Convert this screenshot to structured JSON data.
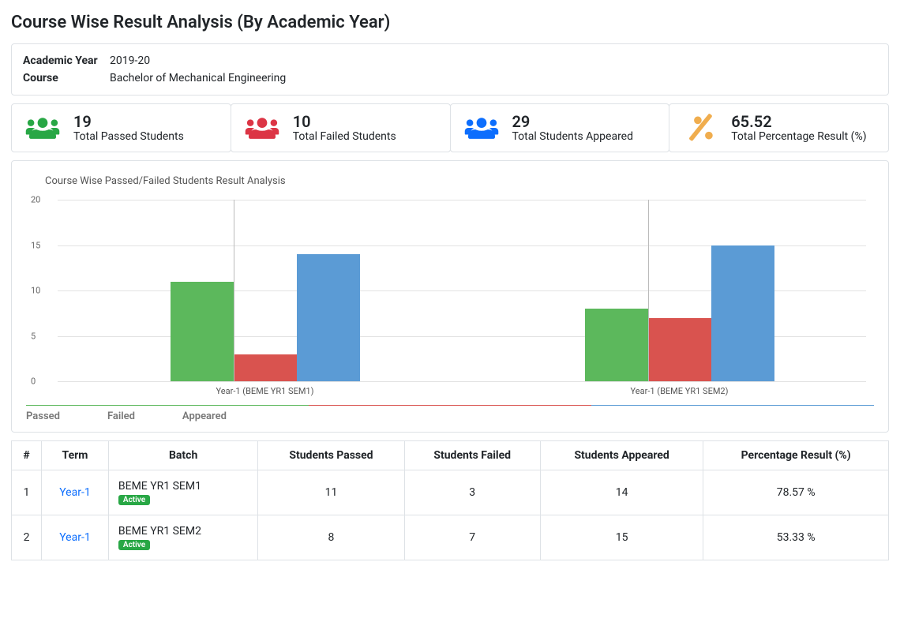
{
  "page_title": "Course Wise Result Analysis (By Academic Year)",
  "info": {
    "academic_year_label": "Academic Year",
    "academic_year_value": "2019-20",
    "course_label": "Course",
    "course_value": "Bachelor of Mechanical Engineering"
  },
  "stats": {
    "passed": {
      "value": "19",
      "label": "Total Passed Students"
    },
    "failed": {
      "value": "10",
      "label": "Total Failed Students"
    },
    "appeared": {
      "value": "29",
      "label": "Total Students Appeared"
    },
    "percentage": {
      "value": "65.52",
      "label": "Total Percentage Result (%)"
    }
  },
  "chart_title": "Course Wise Passed/Failed Students Result Analysis",
  "legend": {
    "passed": "Passed",
    "failed": "Failed",
    "appeared": "Appeared"
  },
  "table": {
    "headers": {
      "idx": "#",
      "term": "Term",
      "batch": "Batch",
      "passed": "Students Passed",
      "failed": "Students Failed",
      "appeared": "Students Appeared",
      "pct": "Percentage Result (%)"
    },
    "rows": [
      {
        "idx": "1",
        "term": "Year-1",
        "batch": "BEME YR1 SEM1",
        "badge": "Active",
        "passed": "11",
        "failed": "3",
        "appeared": "14",
        "pct": "78.57 %"
      },
      {
        "idx": "2",
        "term": "Year-1",
        "batch": "BEME YR1 SEM2",
        "badge": "Active",
        "passed": "8",
        "failed": "7",
        "appeared": "15",
        "pct": "53.33 %"
      }
    ]
  },
  "chart_data": {
    "type": "bar",
    "title": "Course Wise Passed/Failed Students Result Analysis",
    "ylabel": "",
    "xlabel": "",
    "categories": [
      "Year-1 (BEME YR1 SEM1)",
      "Year-1 (BEME YR1 SEM2)"
    ],
    "series": [
      {
        "name": "Passed",
        "values": [
          11,
          3,
          14
        ],
        "_comment": "per-category triplet not used; real series below"
      }
    ],
    "series_real": [
      {
        "name": "Passed",
        "color": "#5cb85c",
        "values": [
          11,
          8
        ]
      },
      {
        "name": "Failed",
        "color": "#d9534f",
        "values": [
          3,
          7
        ]
      },
      {
        "name": "Appeared",
        "color": "#5b9bd5",
        "values": [
          14,
          15
        ]
      }
    ],
    "ylim": [
      0,
      20
    ],
    "yticks": [
      0,
      5,
      10,
      15,
      20
    ]
  }
}
